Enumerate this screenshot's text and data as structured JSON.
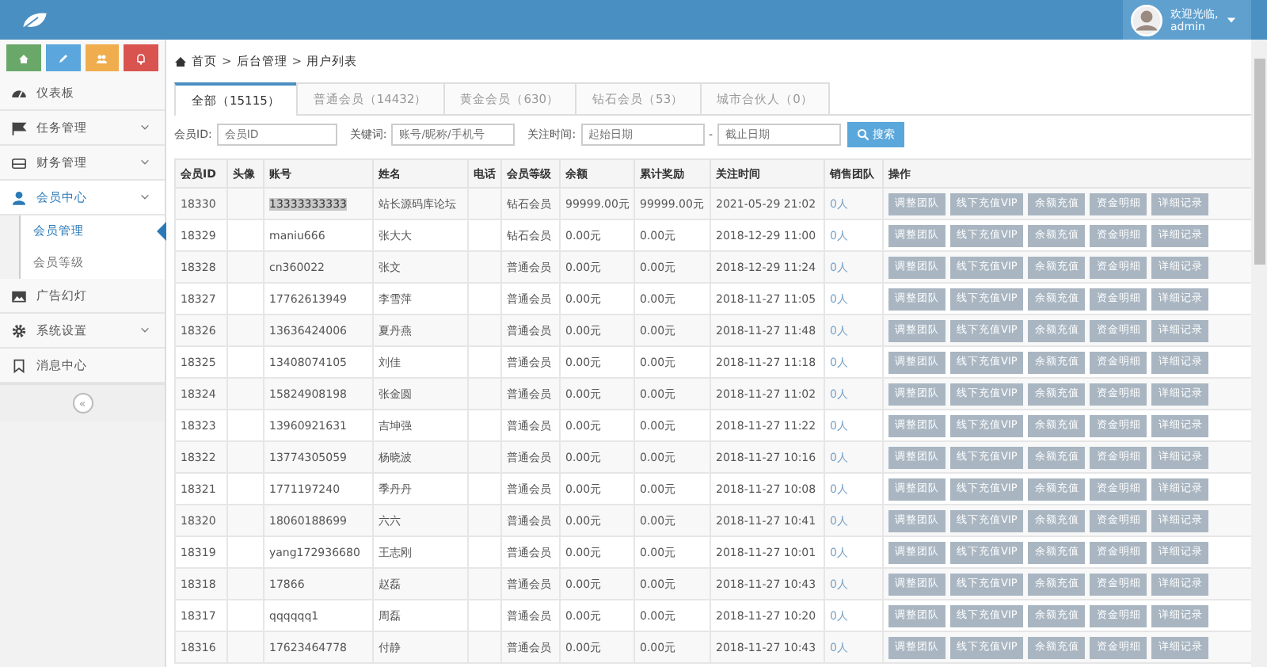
{
  "header": {
    "greeting": "欢迎光临,",
    "user": "admin"
  },
  "sidebar": {
    "quick_buttons": [
      {
        "color": "#6aa86a"
      },
      {
        "color": "#5ba6dc"
      },
      {
        "color": "#f0ad4e"
      },
      {
        "color": "#d9534f"
      }
    ],
    "items": [
      {
        "label": "仪表板",
        "expandable": false,
        "selected": false
      },
      {
        "label": "任务管理",
        "expandable": true,
        "selected": false
      },
      {
        "label": "财务管理",
        "expandable": true,
        "selected": false
      },
      {
        "label": "会员中心",
        "expandable": true,
        "selected": true,
        "children": [
          {
            "label": "会员管理",
            "selected": true
          },
          {
            "label": "会员等级",
            "selected": false
          }
        ]
      },
      {
        "label": "广告幻灯",
        "expandable": false,
        "selected": false
      },
      {
        "label": "系统设置",
        "expandable": true,
        "selected": false
      },
      {
        "label": "消息中心",
        "expandable": false,
        "selected": false
      }
    ],
    "collapse": "«"
  },
  "breadcrumb": {
    "separator": ">",
    "items": [
      "首页",
      "后台管理",
      "用户列表"
    ]
  },
  "tabs": [
    {
      "label": "全部（15115）",
      "selected": true
    },
    {
      "label": "普通会员（14432）",
      "selected": false
    },
    {
      "label": "黄金会员（630）",
      "selected": false
    },
    {
      "label": "钻石会员（53）",
      "selected": false
    },
    {
      "label": "城市合伙人（0）",
      "selected": false
    }
  ],
  "filters": {
    "member_id": {
      "label": "会员ID:",
      "placeholder": "会员ID"
    },
    "keyword": {
      "label": "关键词:",
      "placeholder": "账号/昵称/手机号"
    },
    "follow_time": {
      "label": "关注时间:",
      "start_placeholder": "起始日期",
      "separator": "-",
      "end_placeholder": "截止日期"
    },
    "search_button": "搜索"
  },
  "table": {
    "columns": [
      "会员ID",
      "头像",
      "账号",
      "姓名",
      "电话",
      "会员等级",
      "余额",
      "累计奖励",
      "关注时间",
      "销售团队",
      "操作"
    ],
    "rows": [
      {
        "id": "18330",
        "account": "13333333333",
        "account_selected": true,
        "name": "站长源码库论坛",
        "level": "钻石会员",
        "balance": "99999.00元",
        "reward": "99999.00元",
        "time": "2021-05-29 21:02",
        "team": "0人",
        "actions": [
          "调整团队",
          "线下充值VIP",
          "余额充值",
          "资金明细",
          "详细记录"
        ]
      },
      {
        "id": "18329",
        "account": "maniu666",
        "account_selected": false,
        "name": "张大大",
        "level": "钻石会员",
        "balance": "0.00元",
        "reward": "0.00元",
        "time": "2018-12-29 11:00",
        "team": "0人",
        "actions": [
          "调整团队",
          "线下充值VIP",
          "余额充值",
          "资金明细",
          "详细记录"
        ]
      },
      {
        "id": "18328",
        "account": "cn360022",
        "account_selected": false,
        "name": "张文",
        "level": "普通会员",
        "balance": "0.00元",
        "reward": "0.00元",
        "time": "2018-12-29 11:24",
        "team": "0人",
        "actions": [
          "调整团队",
          "线下充值VIP",
          "余额充值",
          "资金明细",
          "详细记录"
        ]
      },
      {
        "id": "18327",
        "account": "17762613949",
        "account_selected": false,
        "name": "李雪萍",
        "level": "普通会员",
        "balance": "0.00元",
        "reward": "0.00元",
        "time": "2018-11-27 11:05",
        "team": "0人",
        "actions": [
          "调整团队",
          "线下充值VIP",
          "余额充值",
          "资金明细",
          "详细记录"
        ]
      },
      {
        "id": "18326",
        "account": "13636424006",
        "account_selected": false,
        "name": "夏丹燕",
        "level": "普通会员",
        "balance": "0.00元",
        "reward": "0.00元",
        "time": "2018-11-27 11:48",
        "team": "0人",
        "actions": [
          "调整团队",
          "线下充值VIP",
          "余额充值",
          "资金明细",
          "详细记录"
        ]
      },
      {
        "id": "18325",
        "account": "13408074105",
        "account_selected": false,
        "name": "刘佳",
        "level": "普通会员",
        "balance": "0.00元",
        "reward": "0.00元",
        "time": "2018-11-27 11:18",
        "team": "0人",
        "actions": [
          "调整团队",
          "线下充值VIP",
          "余额充值",
          "资金明细",
          "详细记录"
        ]
      },
      {
        "id": "18324",
        "account": "15824908198",
        "account_selected": false,
        "name": "张金圆",
        "level": "普通会员",
        "balance": "0.00元",
        "reward": "0.00元",
        "time": "2018-11-27 11:02",
        "team": "0人",
        "actions": [
          "调整团队",
          "线下充值VIP",
          "余额充值",
          "资金明细",
          "详细记录"
        ]
      },
      {
        "id": "18323",
        "account": "13960921631",
        "account_selected": false,
        "name": "吉坤强",
        "level": "普通会员",
        "balance": "0.00元",
        "reward": "0.00元",
        "time": "2018-11-27 11:22",
        "team": "0人",
        "actions": [
          "调整团队",
          "线下充值VIP",
          "余额充值",
          "资金明细",
          "详细记录"
        ]
      },
      {
        "id": "18322",
        "account": "13774305059",
        "account_selected": false,
        "name": "杨晓波",
        "level": "普通会员",
        "balance": "0.00元",
        "reward": "0.00元",
        "time": "2018-11-27 10:16",
        "team": "0人",
        "actions": [
          "调整团队",
          "线下充值VIP",
          "余额充值",
          "资金明细",
          "详细记录"
        ]
      },
      {
        "id": "18321",
        "account": "1771197240",
        "account_selected": false,
        "name": "季丹丹",
        "level": "普通会员",
        "balance": "0.00元",
        "reward": "0.00元",
        "time": "2018-11-27 10:08",
        "team": "0人",
        "actions": [
          "调整团队",
          "线下充值VIP",
          "余额充值",
          "资金明细",
          "详细记录"
        ]
      },
      {
        "id": "18320",
        "account": "18060188699",
        "account_selected": false,
        "name": "六六",
        "level": "普通会员",
        "balance": "0.00元",
        "reward": "0.00元",
        "time": "2018-11-27 10:41",
        "team": "0人",
        "actions": [
          "调整团队",
          "线下充值VIP",
          "余额充值",
          "资金明细",
          "详细记录"
        ]
      },
      {
        "id": "18319",
        "account": "yang172936680",
        "account_selected": false,
        "name": "王志刚",
        "level": "普通会员",
        "balance": "0.00元",
        "reward": "0.00元",
        "time": "2018-11-27 10:01",
        "team": "0人",
        "actions": [
          "调整团队",
          "线下充值VIP",
          "余额充值",
          "资金明细",
          "详细记录"
        ]
      },
      {
        "id": "18318",
        "account": "17866",
        "account_selected": false,
        "name": "赵磊",
        "level": "普通会员",
        "balance": "0.00元",
        "reward": "0.00元",
        "time": "2018-11-27 10:43",
        "team": "0人",
        "actions": [
          "调整团队",
          "线下充值VIP",
          "余额充值",
          "资金明细",
          "详细记录"
        ]
      },
      {
        "id": "18317",
        "account": "qqqqqq1",
        "account_selected": false,
        "name": "周磊",
        "level": "普通会员",
        "balance": "0.00元",
        "reward": "0.00元",
        "time": "2018-11-27 10:20",
        "team": "0人",
        "actions": [
          "调整团队",
          "线下充值VIP",
          "余额充值",
          "资金明细",
          "详细记录"
        ]
      },
      {
        "id": "18316",
        "account": "17623464778",
        "account_selected": false,
        "name": "付静",
        "level": "普通会员",
        "balance": "0.00元",
        "reward": "0.00元",
        "time": "2018-11-27 10:43",
        "team": "0人",
        "actions": [
          "调整团队",
          "线下充值VIP",
          "余额充值",
          "资金明细",
          "详细记录"
        ]
      }
    ]
  }
}
